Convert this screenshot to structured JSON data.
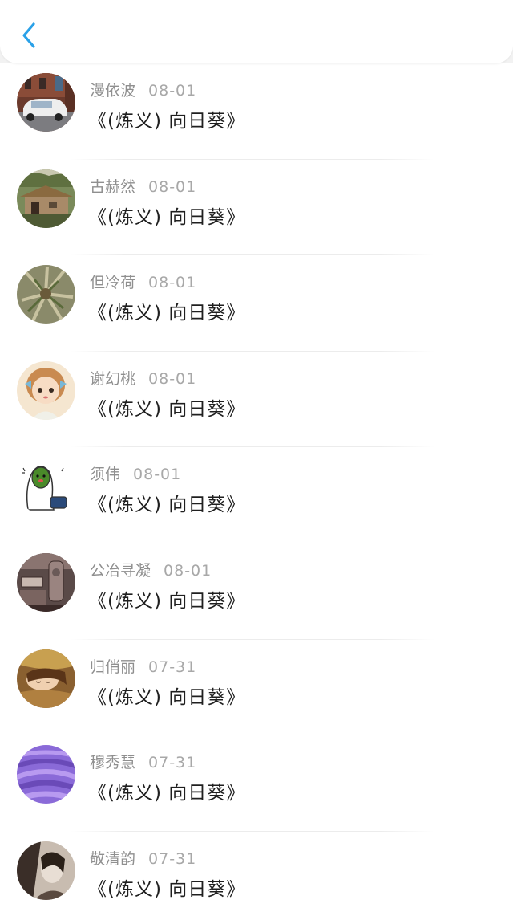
{
  "header": {
    "back_icon": "chevron-left-icon",
    "accent_color": "#2aa1e8"
  },
  "items": [
    {
      "name": "漫依波",
      "date": "08-01",
      "title": "《(炼义) 向日葵》",
      "avatar": "car-photo-avatar"
    },
    {
      "name": "古赫然",
      "date": "08-01",
      "title": "《(炼义) 向日葵》",
      "avatar": "cottage-photo-avatar"
    },
    {
      "name": "但冷荷",
      "date": "08-01",
      "title": "《(炼义) 向日葵》",
      "avatar": "plant-photo-avatar"
    },
    {
      "name": "谢幻桃",
      "date": "08-01",
      "title": "《(炼义) 向日葵》",
      "avatar": "doll-illustration-avatar"
    },
    {
      "name": "须伟",
      "date": "08-01",
      "title": "《(炼义) 向日葵》",
      "avatar": "cartoon-sticker-avatar"
    },
    {
      "name": "公冶寻凝",
      "date": "08-01",
      "title": "《(炼义) 向日葵》",
      "avatar": "vintage-machine-avatar"
    },
    {
      "name": "归俏丽",
      "date": "07-31",
      "title": "《(炼义) 向日葵》",
      "avatar": "girl-in-grass-avatar"
    },
    {
      "name": "穆秀慧",
      "date": "07-31",
      "title": "《(炼义) 向日葵》",
      "avatar": "lavender-field-avatar"
    },
    {
      "name": "敬清韵",
      "date": "07-31",
      "title": "《(炼义) 向日葵》",
      "avatar": "sepia-photo-avatar"
    }
  ]
}
